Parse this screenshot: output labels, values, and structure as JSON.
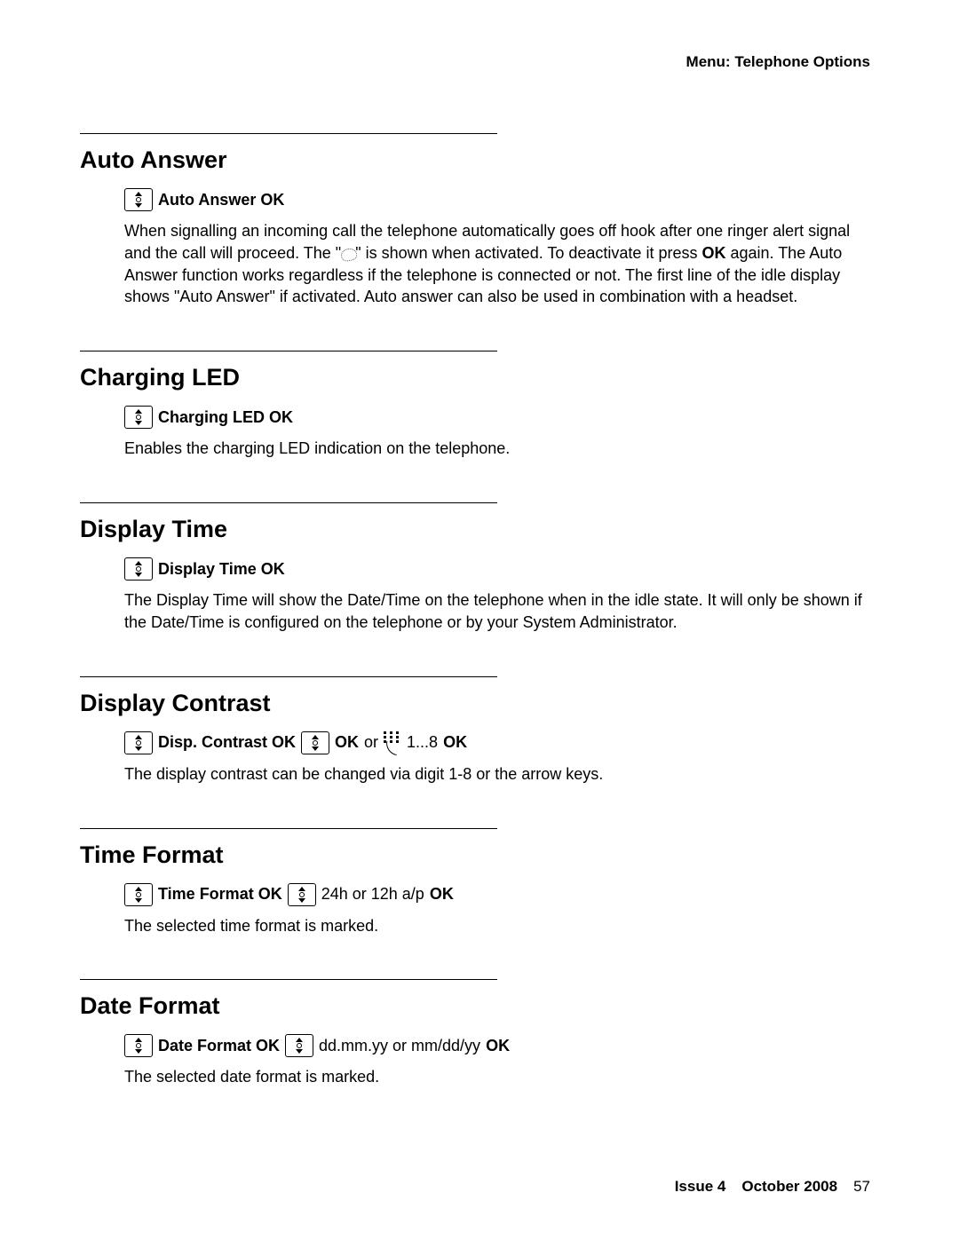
{
  "header": {
    "breadcrumb": "Menu: Telephone Options"
  },
  "sections": {
    "auto_answer": {
      "title": "Auto Answer",
      "nav": "Auto Answer OK",
      "body_before": "When signalling an incoming call the telephone automatically goes off hook after one ringer alert signal and the call will proceed. The \"",
      "body_after": "\" is shown when activated. To deactivate it press ",
      "ok_word": "OK",
      "body_tail": " again. The Auto Answer function works regardless if the telephone is connected or not. The first line of the idle display shows \"Auto Answer\" if activated. Auto answer can also be used in combination with a headset."
    },
    "charging_led": {
      "title": "Charging LED",
      "nav": "Charging LED OK",
      "body": "Enables the charging LED indication on the telephone."
    },
    "display_time": {
      "title": "Display Time",
      "nav": "Display Time OK",
      "body": "The Display Time will show the Date/Time on the telephone when in the idle state. It will only be shown if the Date/Time is configured on the telephone or by your System Administrator."
    },
    "display_contrast": {
      "title": "Display Contrast",
      "nav1": "Disp. Contrast OK",
      "nav2": "OK",
      "or": " or ",
      "nav3": " 1...8 ",
      "nav4": "OK",
      "body": "The display contrast can be changed via digit 1-8 or the arrow keys."
    },
    "time_format": {
      "title": "Time Format",
      "nav1": "Time Format OK",
      "nav2": " 24h or 12h a/p ",
      "nav3": "OK",
      "body": "The selected time format is marked."
    },
    "date_format": {
      "title": "Date Format",
      "nav1": "Date Format OK",
      "nav2": " dd.mm.yy or mm/dd/yy ",
      "nav3": "OK",
      "body": "The selected date format is marked."
    }
  },
  "footer": {
    "issue": "Issue 4",
    "date": "October 2008",
    "page": "57"
  }
}
